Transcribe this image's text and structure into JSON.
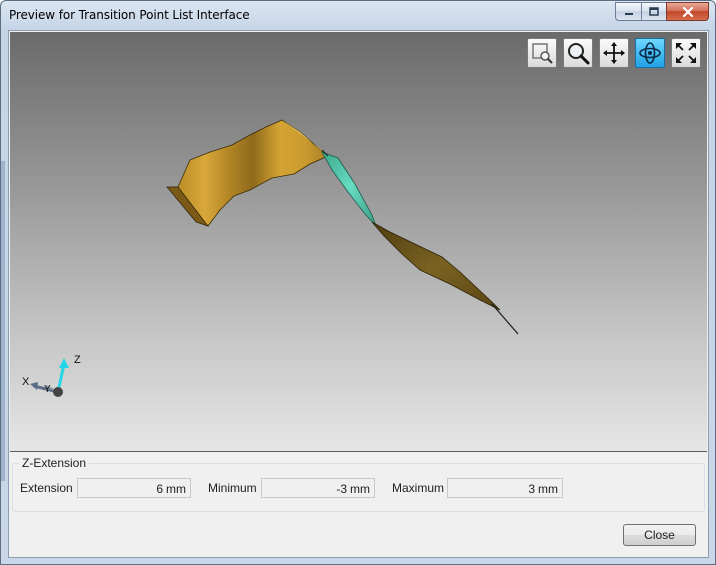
{
  "window": {
    "title": "Preview for Transition Point List Interface"
  },
  "caption_buttons": {
    "minimize": "minimize-icon",
    "maximize": "maximize-icon",
    "close": "close-icon"
  },
  "toolbar": {
    "tools": [
      {
        "name": "zoom-window",
        "icon": "zoom-window-icon",
        "active": false
      },
      {
        "name": "zoom",
        "icon": "magnifier-icon",
        "active": false
      },
      {
        "name": "pan",
        "icon": "pan-arrows-icon",
        "active": false
      },
      {
        "name": "rotate",
        "icon": "rotate-orbit-icon",
        "active": true
      },
      {
        "name": "fit-all",
        "icon": "fit-all-icon",
        "active": false
      }
    ],
    "active_color": "#1fa2e4"
  },
  "triad": {
    "x_label": "X",
    "y_label": "Y",
    "z_label": "Z"
  },
  "z_extension": {
    "group_label": "Z-Extension",
    "extension_label": "Extension",
    "extension_value": "6",
    "minimum_label": "Minimum",
    "minimum_value": "-3",
    "maximum_label": "Maximum",
    "maximum_value": "3",
    "unit": "mm"
  },
  "buttons": {
    "close_label": "Close"
  },
  "colors": {
    "surface_gold": "#c89a2c",
    "surface_teal": "#5fd0b4",
    "surface_dark": "#6a5418"
  }
}
